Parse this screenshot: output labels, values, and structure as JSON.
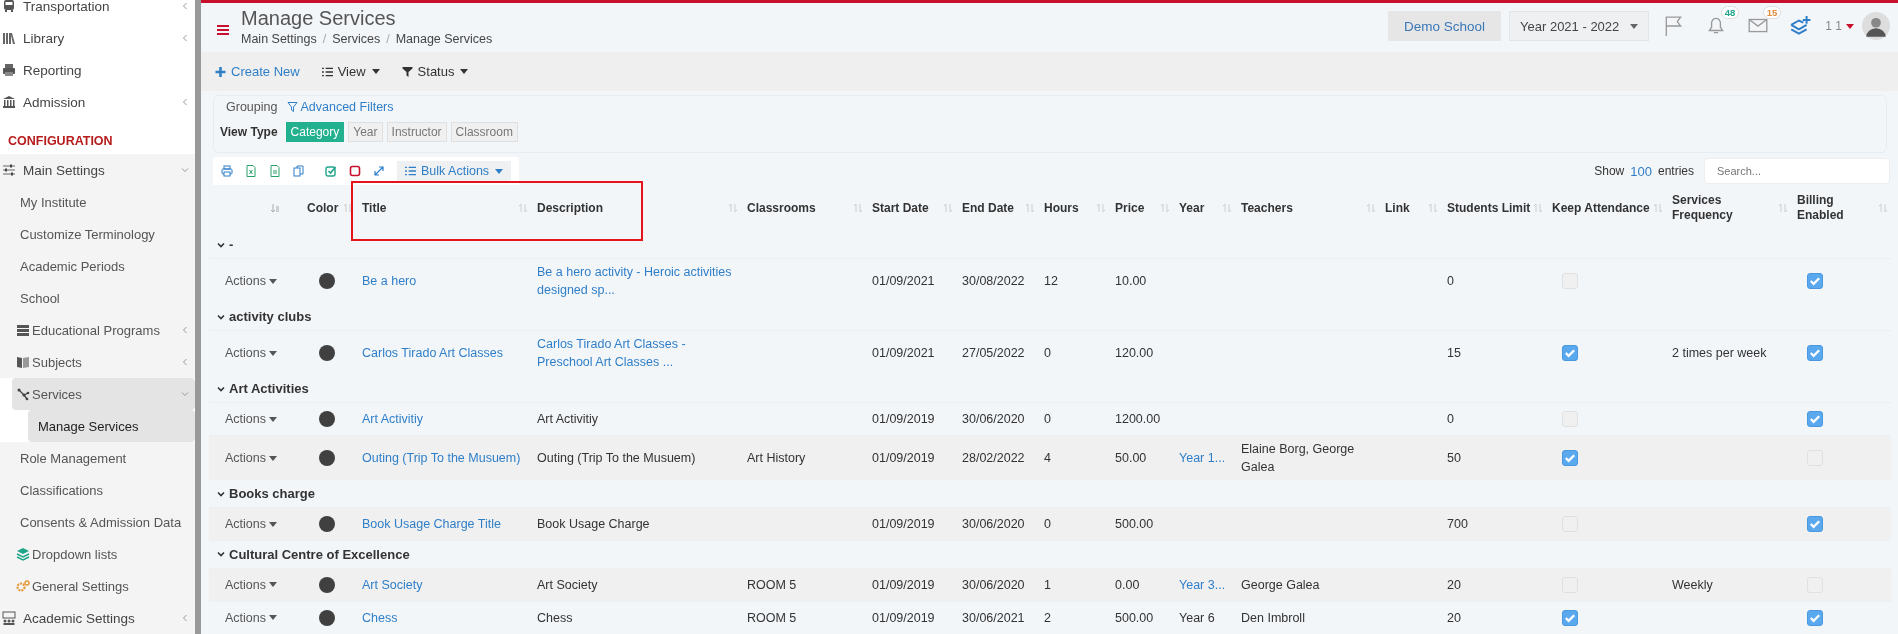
{
  "sidebar": {
    "items": [
      {
        "label": "Transportation",
        "kind": "group",
        "expanded": false,
        "selected": false
      },
      {
        "label": "Library",
        "kind": "group",
        "expanded": false,
        "selected": false
      },
      {
        "label": "Reporting",
        "kind": "link",
        "selected": false
      },
      {
        "label": "Admission",
        "kind": "group",
        "expanded": false,
        "selected": false
      },
      {
        "label": "CONFIGURATION",
        "kind": "section"
      },
      {
        "label": "Main Settings",
        "kind": "group",
        "expanded": true,
        "selected": false,
        "children": [
          {
            "label": "My Institute",
            "kind": "link",
            "selected": false
          },
          {
            "label": "Customize Terminology",
            "kind": "link",
            "selected": false
          },
          {
            "label": "Academic Periods",
            "kind": "link",
            "selected": false
          },
          {
            "label": "School",
            "kind": "link",
            "selected": false
          },
          {
            "label": "Educational Programs",
            "kind": "group",
            "expanded": false,
            "selected": false
          },
          {
            "label": "Subjects",
            "kind": "group",
            "expanded": false,
            "selected": false
          },
          {
            "label": "Services",
            "kind": "group",
            "expanded": true,
            "selected": true,
            "children": [
              {
                "label": "Manage Services",
                "kind": "link",
                "selected": true
              }
            ]
          },
          {
            "label": "Role Management",
            "kind": "link",
            "selected": false
          },
          {
            "label": "Classifications",
            "kind": "link",
            "selected": false
          },
          {
            "label": "Consents & Admission Data",
            "kind": "link",
            "selected": false
          },
          {
            "label": "Dropdown lists",
            "kind": "link",
            "selected": false
          },
          {
            "label": "General Settings",
            "kind": "link",
            "selected": false
          }
        ]
      },
      {
        "label": "Academic Settings",
        "kind": "group",
        "expanded": false,
        "selected": false
      }
    ]
  },
  "header": {
    "title": "Manage Services",
    "breadcrumb": [
      "Main Settings",
      "/",
      "Services",
      "/",
      "Manage Services"
    ],
    "school": "Demo School",
    "year": "Year 2021 - 2022",
    "notifications": "48",
    "messages": "15",
    "user": "1 1"
  },
  "toolbar": {
    "create": "Create New",
    "view": "View",
    "status": "Status"
  },
  "grouping": {
    "legend": "Grouping",
    "advanced": "Advanced Filters",
    "view_type_label": "View Type",
    "view_types": [
      {
        "label": "Category",
        "selected": true
      },
      {
        "label": "Year",
        "selected": false
      },
      {
        "label": "Instructor",
        "selected": false
      },
      {
        "label": "Classroom",
        "selected": false
      }
    ]
  },
  "table_tools": {
    "bulk": "Bulk Actions",
    "show": "Show",
    "entries_count": "100",
    "entries": "entries",
    "search_placeholder": "Search..."
  },
  "table": {
    "columns": [
      "Color",
      "Title",
      "Description",
      "Classrooms",
      "Start Date",
      "End Date",
      "Hours",
      "Price",
      "Year",
      "Teachers",
      "Link",
      "Students Limit",
      "Keep Attendance",
      "Services Frequency",
      "Billing Enabled"
    ],
    "groups": [
      {
        "label": "-",
        "expanded": true,
        "rows": [
          {
            "actions": "Actions",
            "color": "#404040",
            "title": "Be a hero",
            "description": "Be a hero activity - Heroic activities designed sp...",
            "description_link": true,
            "start": "01/09/2021",
            "end": "30/08/2022",
            "hours": "12",
            "price": "10.00",
            "students_limit": "0",
            "keep_attendance": false,
            "billing_enabled": true
          }
        ]
      },
      {
        "label": "activity clubs",
        "expanded": true,
        "rows": [
          {
            "actions": "Actions",
            "color": "#404040",
            "title": "Carlos Tirado Art Classes",
            "description": "Carlos Tirado Art Classes - Preschool Art Classes ...",
            "description_link": true,
            "start": "01/09/2021",
            "end": "27/05/2022",
            "hours": "0",
            "price": "120.00",
            "students_limit": "15",
            "keep_attendance": true,
            "frequency": "2 times per week",
            "billing_enabled": true
          }
        ]
      },
      {
        "label": "Art Activities",
        "expanded": true,
        "rows": [
          {
            "actions": "Actions",
            "color": "#404040",
            "title": "Art Activitiy",
            "description": "Art Activitiy",
            "description_link": false,
            "start": "01/09/2019",
            "end": "30/06/2020",
            "hours": "0",
            "price": "1200.00",
            "students_limit": "0",
            "keep_attendance": false,
            "billing_enabled": true
          },
          {
            "actions": "Actions",
            "color": "#404040",
            "title": "Outing (Trip To the Musuem)",
            "description": "Outing (Trip To the Musuem)",
            "description_link": false,
            "classrooms": "Art History",
            "start": "01/09/2019",
            "end": "28/02/2022",
            "hours": "4",
            "price": "50.00",
            "year": "Year 1...",
            "year_link": true,
            "teachers": "Elaine Borg, George Galea",
            "students_limit": "50",
            "keep_attendance": true,
            "billing_enabled": false
          }
        ]
      },
      {
        "label": "Books charge",
        "expanded": true,
        "rows": [
          {
            "actions": "Actions",
            "color": "#404040",
            "title": "Book Usage Charge Title",
            "description": "Book Usage Charge",
            "description_link": false,
            "start": "01/09/2019",
            "end": "30/06/2020",
            "hours": "0",
            "price": "500.00",
            "students_limit": "700",
            "keep_attendance": false,
            "billing_enabled": true
          }
        ]
      },
      {
        "label": "Cultural Centre of Excellence",
        "expanded": true,
        "rows": [
          {
            "actions": "Actions",
            "color": "#404040",
            "title": "Art Society",
            "description": "Art Society",
            "description_link": false,
            "classrooms": "ROOM 5",
            "start": "01/09/2019",
            "end": "30/06/2020",
            "hours": "1",
            "price": "0.00",
            "year": "Year 3...",
            "year_link": true,
            "teachers": "George Galea",
            "students_limit": "20",
            "keep_attendance": false,
            "frequency": "Weekly",
            "billing_enabled": false
          },
          {
            "actions": "Actions",
            "color": "#404040",
            "title": "Chess",
            "description": "Chess",
            "description_link": false,
            "classrooms": "ROOM 5",
            "start": "01/09/2019",
            "end": "30/06/2021",
            "hours": "2",
            "price": "500.00",
            "year": "Year 6",
            "year_link": false,
            "teachers": "Den Imbroll",
            "students_limit": "20",
            "keep_attendance": true,
            "billing_enabled": true
          }
        ]
      }
    ]
  }
}
